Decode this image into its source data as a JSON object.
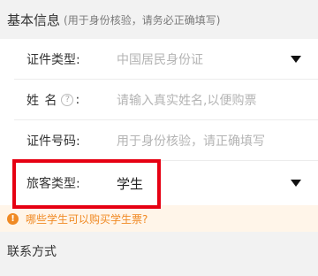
{
  "basic_info": {
    "title": "基本信息",
    "hint": "(用于身份核验，请务必正确填写)"
  },
  "fields": {
    "id_type": {
      "label": "证件类型:",
      "value": "中国居民身份证",
      "icon": "triangle-down-icon"
    },
    "name": {
      "label": "姓 名",
      "help_glyph": "?",
      "colon": ":",
      "placeholder": "请输入真实姓名,以便购票"
    },
    "id_number": {
      "label": "证件号码:",
      "placeholder": "用于身份核验，请正确填写"
    },
    "passenger_type": {
      "label": "旅客类型:",
      "value": "学生",
      "icon": "triangle-down-icon"
    }
  },
  "notice": {
    "icon_glyph": "!",
    "text": "哪些学生可以购买学生票?",
    "color": "#f08a24"
  },
  "contact": {
    "title": "联系方式"
  },
  "colors": {
    "highlight_border": "#e60012",
    "notice_bg": "#fff5e9",
    "page_bg": "#f2f2f2"
  }
}
